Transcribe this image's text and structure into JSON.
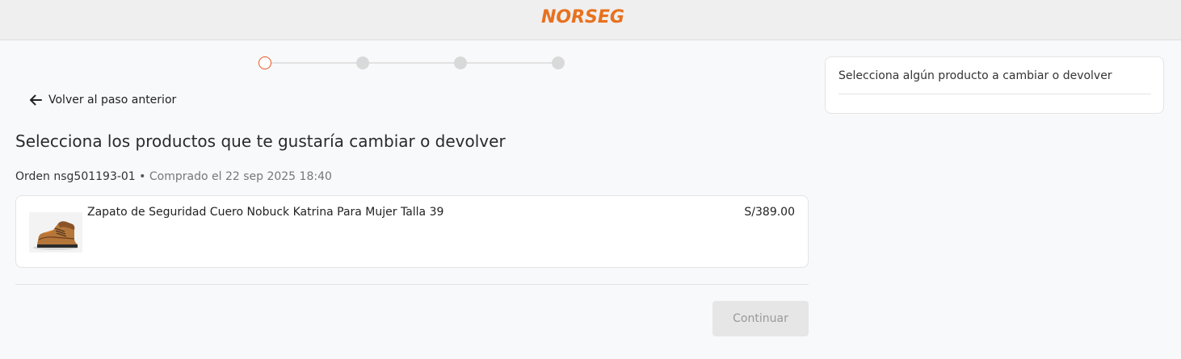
{
  "brand": {
    "logo_text": "NORSEG",
    "color": "#e8711e"
  },
  "stepper": {
    "total_steps": 4,
    "current_step": 1,
    "active_color": "#e8541e"
  },
  "back_link": {
    "label": "Volver al paso anterior",
    "icon": "arrow-left-icon"
  },
  "page": {
    "title": "Selecciona los productos que te gustaría cambiar o devolver"
  },
  "order": {
    "number": "Orden nsg501193-01",
    "separator": "•",
    "purchased": "Comprado el 22 sep 2025 18:40"
  },
  "product": {
    "name": "Zapato de Seguridad Cuero Nobuck Katrina Para Mujer Talla 39",
    "price": "S/389.00",
    "image": "safety-boot-image"
  },
  "actions": {
    "continue_label": "Continuar"
  },
  "side_panel": {
    "message": "Selecciona algún producto a cambiar o devolver"
  }
}
